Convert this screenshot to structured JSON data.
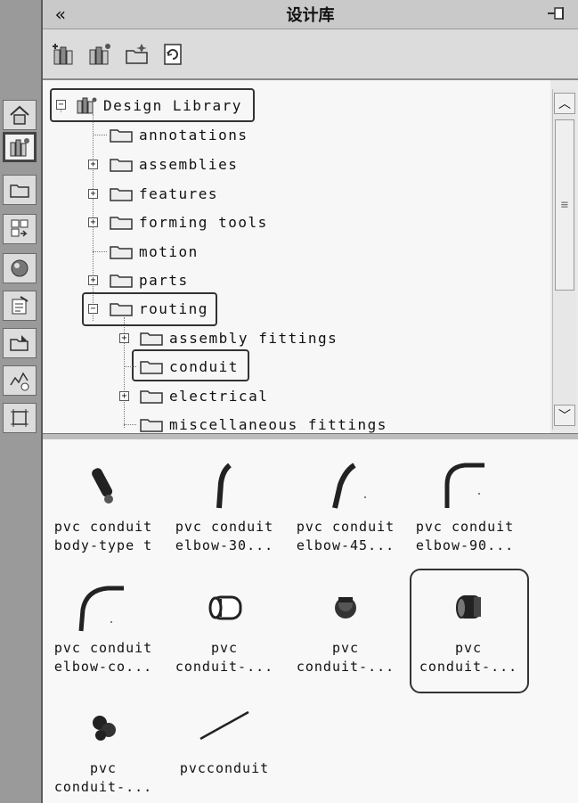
{
  "panel": {
    "title": "设计库"
  },
  "toolbar": {
    "buttons": [
      {
        "name": "add-to-library-button",
        "icon": "library-add-icon"
      },
      {
        "name": "add-file-location-button",
        "icon": "library-location-icon"
      },
      {
        "name": "create-new-folder-button",
        "icon": "new-folder-icon"
      },
      {
        "name": "refresh-button",
        "icon": "refresh-icon"
      }
    ]
  },
  "sidebar": {
    "tabs": [
      {
        "name": "home-tab",
        "icon": "home-icon"
      },
      {
        "name": "design-library-tab",
        "icon": "design-library-icon",
        "active": true
      },
      {
        "name": "file-explorer-tab",
        "icon": "folder-icon"
      },
      {
        "name": "view-palette-tab",
        "icon": "view-palette-icon"
      },
      {
        "name": "appearances-tab",
        "icon": "sphere-icon"
      },
      {
        "name": "custom-properties-tab",
        "icon": "properties-icon"
      },
      {
        "name": "open-folder-tab",
        "icon": "open-folder-icon"
      },
      {
        "name": "motion-tab",
        "icon": "motion-icon"
      },
      {
        "name": "sketch-tab",
        "icon": "sketch-icon"
      }
    ]
  },
  "tree": {
    "root": "Design Library",
    "items": [
      {
        "label": "annotations",
        "level": 1,
        "expandable": false
      },
      {
        "label": "assemblies",
        "level": 1,
        "expandable": true
      },
      {
        "label": "features",
        "level": 1,
        "expandable": true
      },
      {
        "label": "forming tools",
        "level": 1,
        "expandable": true
      },
      {
        "label": "motion",
        "level": 1,
        "expandable": false
      },
      {
        "label": "parts",
        "level": 1,
        "expandable": true
      },
      {
        "label": "routing",
        "level": 1,
        "expandable": true,
        "expanded": true
      },
      {
        "label": "assembly fittings",
        "level": 2,
        "expandable": true
      },
      {
        "label": "conduit",
        "level": 2,
        "expandable": false,
        "selected": true
      },
      {
        "label": "electrical",
        "level": 2,
        "expandable": true
      },
      {
        "label": "miscellaneous fittings",
        "level": 2,
        "expandable": false
      }
    ]
  },
  "files": [
    {
      "line1": "pvc conduit",
      "line2": "body-type t"
    },
    {
      "line1": "pvc conduit",
      "line2": "elbow-30..."
    },
    {
      "line1": "pvc conduit",
      "line2": "elbow-45..."
    },
    {
      "line1": "pvc conduit",
      "line2": "elbow-90..."
    },
    {
      "line1": "pvc conduit",
      "line2": "elbow-co..."
    },
    {
      "line1": "pvc",
      "line2": "conduit-..."
    },
    {
      "line1": "pvc",
      "line2": "conduit-..."
    },
    {
      "line1": "pvc",
      "line2": "conduit-...",
      "selected": true
    },
    {
      "line1": "pvc",
      "line2": "conduit-..."
    },
    {
      "line1": "pvcconduit",
      "line2": ""
    }
  ],
  "colors": {
    "panel_bg": "#e9e9e9",
    "tree_bg": "#f7f7f7",
    "highlight_border": "#333333"
  }
}
